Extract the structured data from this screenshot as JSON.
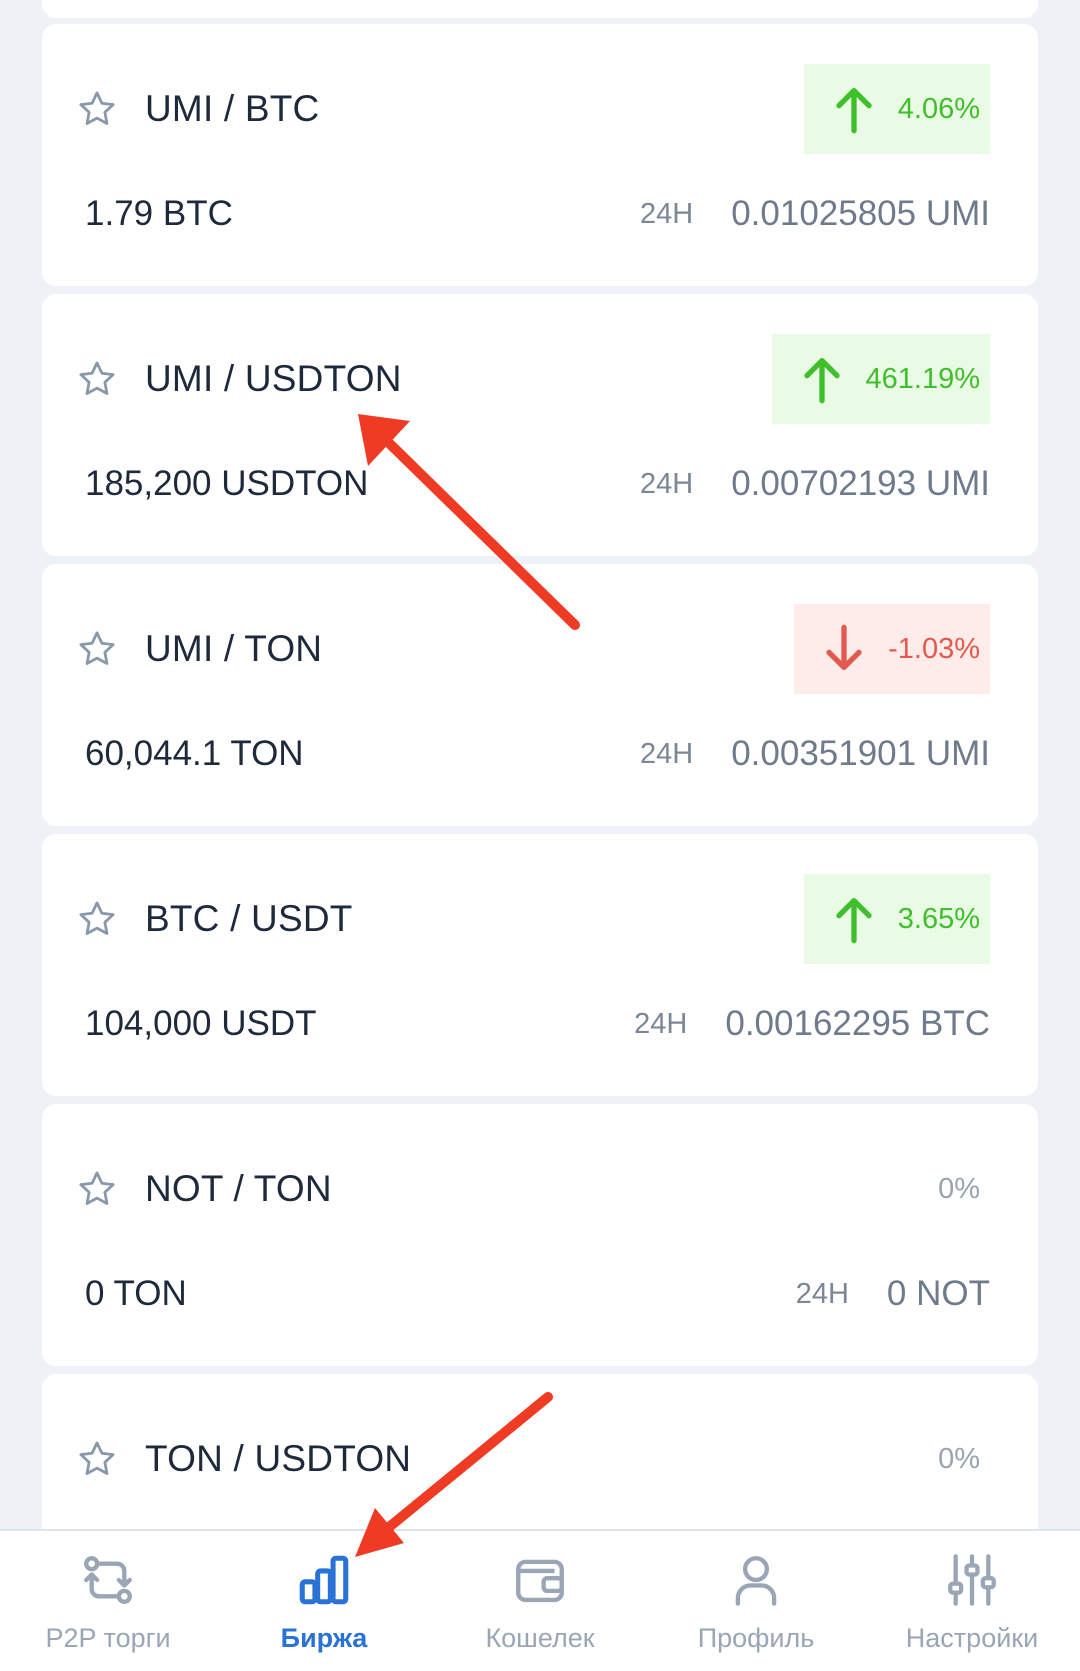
{
  "pairs": [
    {
      "name": "UMI / BTC",
      "change": "4.06%",
      "trend": "up",
      "volume": "1.79 BTC",
      "period": "24H",
      "price": "0.01025805 UMI"
    },
    {
      "name": "UMI / USDTON",
      "change": "461.19%",
      "trend": "up",
      "volume": "185,200 USDTON",
      "period": "24H",
      "price": "0.00702193 UMI"
    },
    {
      "name": "UMI / TON",
      "change": "-1.03%",
      "trend": "down",
      "volume": "60,044.1 TON",
      "period": "24H",
      "price": "0.00351901 UMI"
    },
    {
      "name": "BTC / USDT",
      "change": "3.65%",
      "trend": "up",
      "volume": "104,000 USDT",
      "period": "24H",
      "price": "0.00162295 BTC"
    },
    {
      "name": "NOT / TON",
      "change": "0%",
      "trend": "flat",
      "volume": "0 TON",
      "period": "24H",
      "price": "0 NOT"
    },
    {
      "name": "TON / USDTON",
      "change": "0%",
      "trend": "flat",
      "volume": "",
      "period": "",
      "price": ""
    }
  ],
  "nav": [
    {
      "label": "P2P торги",
      "icon": "p2p-swap-icon",
      "active": false
    },
    {
      "label": "Биржа",
      "icon": "exchange-chart-icon",
      "active": true
    },
    {
      "label": "Кошелек",
      "icon": "wallet-icon",
      "active": false
    },
    {
      "label": "Профиль",
      "icon": "profile-icon",
      "active": false
    },
    {
      "label": "Настройки",
      "icon": "settings-sliders-icon",
      "active": false
    }
  ],
  "colors": {
    "up": "#3fbf2b",
    "up_bg": "#e9fbe4",
    "down": "#e25a4f",
    "down_bg": "#fdecea",
    "accent": "#2a73d6",
    "annotation_arrow": "#ef3b24"
  }
}
